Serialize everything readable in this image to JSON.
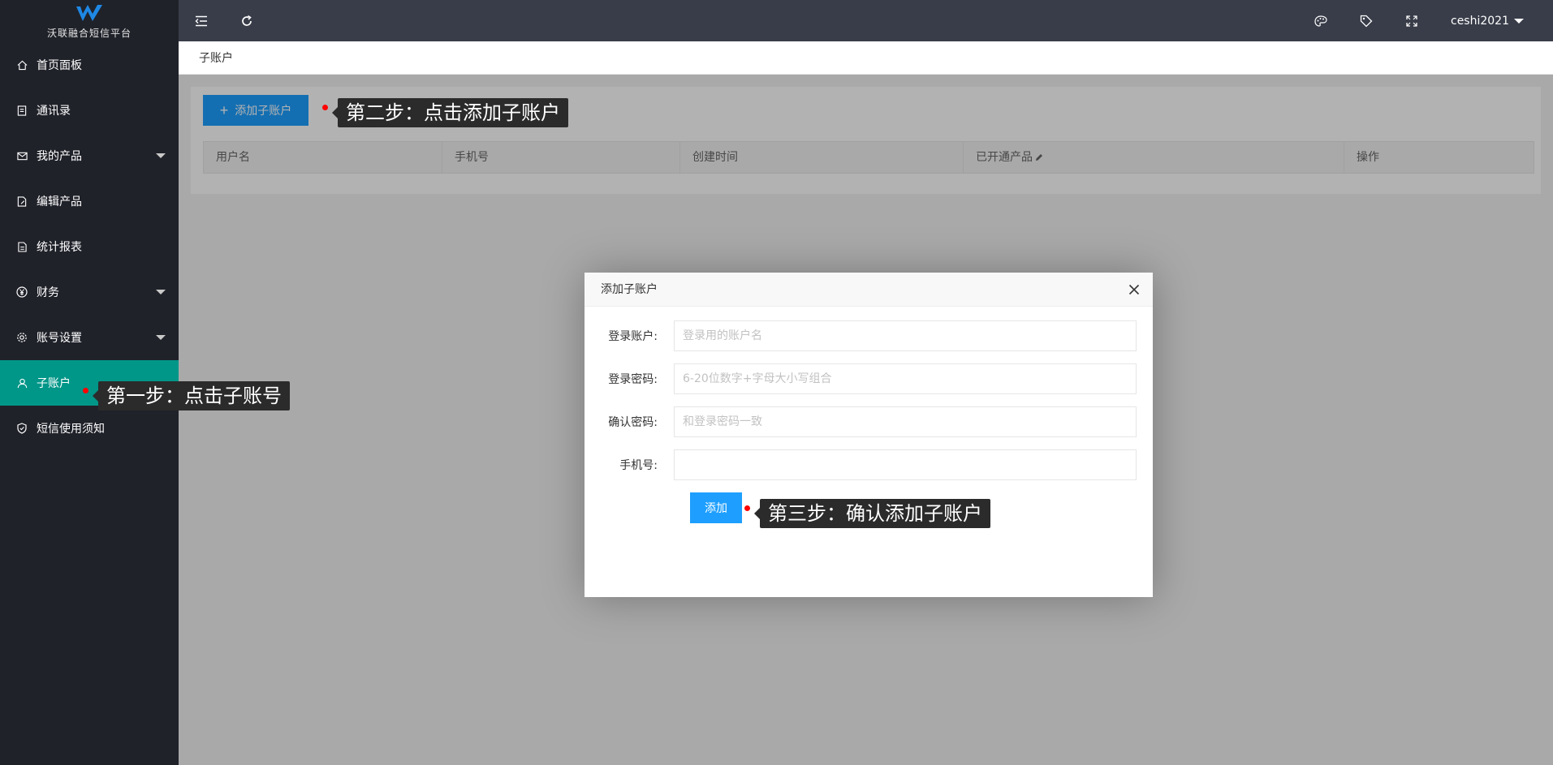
{
  "sidebar": {
    "brand": "沃联融合短信平台",
    "items": [
      {
        "label": "首页面板",
        "icon": "home-icon"
      },
      {
        "label": "通讯录",
        "icon": "contacts-icon"
      },
      {
        "label": "我的产品",
        "icon": "mail-icon",
        "has_submenu": true
      },
      {
        "label": "编辑产品",
        "icon": "edit-doc-icon"
      },
      {
        "label": "统计报表",
        "icon": "report-icon"
      },
      {
        "label": "财务",
        "icon": "yen-icon",
        "has_submenu": true
      },
      {
        "label": "账号设置",
        "icon": "gear-icon",
        "has_submenu": true
      },
      {
        "label": "子账户",
        "icon": "user-icon",
        "active": true
      },
      {
        "label": "短信使用须知",
        "icon": "shield-icon"
      }
    ]
  },
  "header": {
    "username": "ceshi2021",
    "icons": [
      "menu-collapse-icon",
      "refresh-icon",
      "theme-icon",
      "tag-icon",
      "fullscreen-icon"
    ]
  },
  "tabbar": {
    "current": "子账户"
  },
  "main": {
    "add_button": "添加子账户",
    "table_headers": [
      "用户名",
      "手机号",
      "创建时间",
      "已开通产品",
      "操作"
    ]
  },
  "dialog": {
    "title": "添加子账户",
    "fields": [
      {
        "label": "登录账户:",
        "placeholder": "登录用的账户名",
        "value": ""
      },
      {
        "label": "登录密码:",
        "placeholder": "6-20位数字+字母大小写组合",
        "value": ""
      },
      {
        "label": "确认密码:",
        "placeholder": "和登录密码一致",
        "value": ""
      },
      {
        "label": "手机号:",
        "placeholder": "",
        "value": ""
      }
    ],
    "submit_label": "添加"
  },
  "annotations": {
    "step1": "第一步：点击子账号",
    "step2": "第二步：点击添加子账户",
    "step3": "第三步：确认添加子账户"
  },
  "colors": {
    "sidebar_bg": "#20222a",
    "header_bg": "#393d49",
    "active_bg": "#009688",
    "primary": "#1e9fff"
  }
}
